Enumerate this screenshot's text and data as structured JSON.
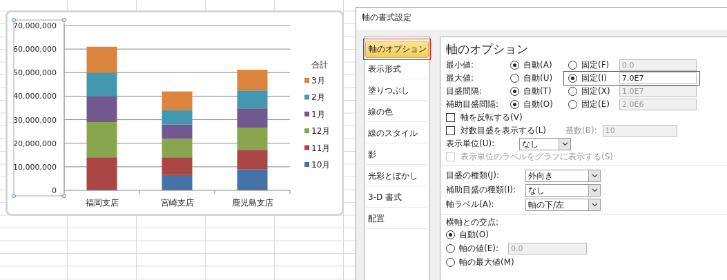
{
  "chart": {
    "chart_data": {
      "type": "bar",
      "stacked": true,
      "orientation": "vertical",
      "grid": true,
      "legend": {
        "title": "合計"
      },
      "categories": [
        "福岡支店",
        "宮崎支店",
        "鹿児島支店"
      ],
      "ylim": [
        0,
        70000000
      ],
      "yticks": [
        {
          "value": 0,
          "label": "0"
        },
        {
          "value": 10000000,
          "label": "10,000,000"
        },
        {
          "value": 20000000,
          "label": "20,000,000"
        },
        {
          "value": 30000000,
          "label": "30,000,000"
        },
        {
          "value": 40000000,
          "label": "40,000,000"
        },
        {
          "value": 50000000,
          "label": "50,000,000"
        },
        {
          "value": 60000000,
          "label": "60,000,000"
        },
        {
          "value": 70000000,
          "label": "70,000,000"
        }
      ],
      "series": [
        {
          "name": "10月",
          "color": "#4572a7",
          "values": [
            0,
            6500000,
            9000000
          ]
        },
        {
          "name": "11月",
          "color": "#aa4643",
          "values": [
            14000000,
            7500000,
            8200000
          ]
        },
        {
          "name": "12月",
          "color": "#89a54e",
          "values": [
            15000000,
            8000000,
            9400000
          ]
        },
        {
          "name": "1月",
          "color": "#71588f",
          "values": [
            11000000,
            6000000,
            8200000
          ]
        },
        {
          "name": "2月",
          "color": "#4198af",
          "values": [
            10000000,
            6000000,
            7600000
          ]
        },
        {
          "name": "3月",
          "color": "#db843d",
          "values": [
            11000000,
            8000000,
            8800000
          ]
        }
      ]
    }
  },
  "dialog": {
    "title": "軸の書式設定",
    "nav": [
      {
        "label": "軸のオプション",
        "selected": true,
        "highlighted": true
      },
      {
        "label": "表示形式",
        "selected": false,
        "highlighted": false
      },
      {
        "label": "塗りつぶし",
        "selected": false,
        "highlighted": false
      },
      {
        "label": "線の色",
        "selected": false,
        "highlighted": false
      },
      {
        "label": "線のスタイル",
        "selected": false,
        "highlighted": false
      },
      {
        "label": "影",
        "selected": false,
        "highlighted": false
      },
      {
        "label": "光彩とぼかし",
        "selected": false,
        "highlighted": false
      },
      {
        "label": "3-D 書式",
        "selected": false,
        "highlighted": false
      },
      {
        "label": "配置",
        "selected": false,
        "highlighted": false
      }
    ],
    "panel_title": "軸のオプション",
    "scale_rows": [
      {
        "label": "最小値:",
        "auto": {
          "label": "自動(A)",
          "selected": true
        },
        "fixed": {
          "label": "固定(F)",
          "selected": false
        },
        "value": "0.0",
        "disabled": true,
        "highlighted": false
      },
      {
        "label": "最大値:",
        "auto": {
          "label": "自動(U)",
          "selected": false
        },
        "fixed": {
          "label": "固定(I)",
          "selected": true
        },
        "value": "7.0E7",
        "disabled": false,
        "highlighted": true
      },
      {
        "label": "目盛間隔:",
        "auto": {
          "label": "自動(T)",
          "selected": true
        },
        "fixed": {
          "label": "固定(X)",
          "selected": false
        },
        "value": "1.0E7",
        "disabled": true,
        "highlighted": false
      },
      {
        "label": "補助目盛間隔:",
        "auto": {
          "label": "自動(O)",
          "selected": true
        },
        "fixed": {
          "label": "固定(E)",
          "selected": false
        },
        "value": "2.0E6",
        "disabled": true,
        "highlighted": false
      }
    ],
    "options": [
      {
        "kind": "checkbox",
        "label": "軸を反転する(V)",
        "checked": false,
        "disabled": false
      },
      {
        "kind": "checkbox",
        "label": "対数目盛を表示する(L)",
        "checked": false,
        "disabled": false,
        "base_label": "基数(B):",
        "base_value": "10"
      },
      {
        "kind": "dropdown",
        "label": "表示単位(U):",
        "value": "なし"
      },
      {
        "kind": "checkbox",
        "label": "表示単位のラベルをグラフに表示する(S)",
        "checked": false,
        "disabled": true
      }
    ],
    "dropdowns": [
      {
        "label": "目盛の種類(J):",
        "value": "外向き"
      },
      {
        "label": "補助目盛の種類(I):",
        "value": "なし"
      },
      {
        "label": "軸ラベル(A):",
        "value": "軸の下/左"
      }
    ],
    "crossing": {
      "title": "横軸との交点:",
      "choices": [
        {
          "label": "自動(O)",
          "selected": true
        },
        {
          "label": "軸の値(E):",
          "selected": false,
          "value": "0.0"
        },
        {
          "label": "軸の最大値(M)",
          "selected": false
        }
      ]
    }
  }
}
